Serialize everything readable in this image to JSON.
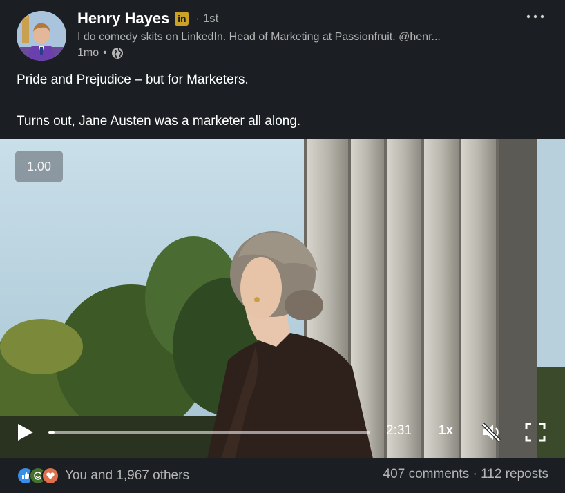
{
  "author": {
    "name": "Henry Hayes",
    "badge": "in",
    "degree": "· 1st",
    "headline": "I do comedy skits on LinkedIn. Head of Marketing at Passionfruit. @henr...",
    "time": "1mo",
    "visibility_icon": "globe-icon"
  },
  "post": {
    "line1": "Pride and Prejudice – but for Marketers.",
    "line2": "Turns out, Jane Austen was a marketer all along."
  },
  "video": {
    "speed_badge": "1.00",
    "duration": "2:31",
    "rate": "1x",
    "progress_fraction": 0.02,
    "muted": true
  },
  "social": {
    "reaction_icons": [
      "like-icon",
      "celebrate-icon",
      "love-icon"
    ],
    "reactions_text": "You and 1,967 others",
    "comments": "407 comments",
    "separator": "·",
    "reposts": "112 reposts"
  },
  "colors": {
    "background": "#1b1f23",
    "badge_gold": "#c9a227",
    "like_blue": "#378fe9",
    "celebrate_green": "#44712e",
    "love_red": "#df704d"
  }
}
